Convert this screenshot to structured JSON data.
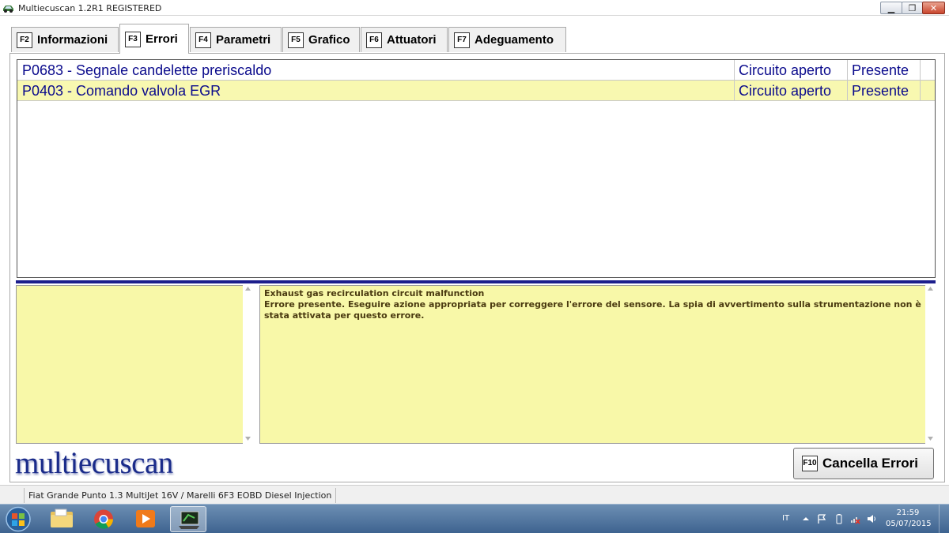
{
  "window": {
    "title": "Multiecuscan 1.2R1 REGISTERED",
    "min_glyph": "▁",
    "max_glyph": "❐",
    "close_glyph": "✕"
  },
  "tabs": [
    {
      "key": "F2",
      "label": "Informazioni"
    },
    {
      "key": "F3",
      "label": "Errori"
    },
    {
      "key": "F4",
      "label": "Parametri"
    },
    {
      "key": "F5",
      "label": "Grafico"
    },
    {
      "key": "F6",
      "label": "Attuatori"
    },
    {
      "key": "F7",
      "label": "Adeguamento"
    }
  ],
  "errors": [
    {
      "code_desc": "P0683 - Segnale candelette preriscaldo",
      "status": "Circuito aperto",
      "presence": "Presente"
    },
    {
      "code_desc": "P0403 - Comando valvola EGR",
      "status": "Circuito aperto",
      "presence": "Presente"
    }
  ],
  "description": {
    "line1": "Exhaust gas recirculation circuit malfunction",
    "line2": "Errore presente. Eseguire azione appropriata per correggere l'errore del sensore. La spia di avvertimento sulla strumentazione non è stata attivata per questo errore."
  },
  "brand": "multiecuscan",
  "clear_button": {
    "key": "F10",
    "label": "Cancella Errori"
  },
  "status_bar": {
    "vehicle": "Fiat Grande Punto 1.3 MultiJet 16V / Marelli 6F3 EOBD Diesel Injection"
  },
  "taskbar": {
    "language": "IT",
    "time": "21:59",
    "date": "05/07/2015"
  },
  "colors": {
    "selected_row": "#f8f8b0",
    "error_text": "#0a0a8c",
    "divider": "#1c1e8c",
    "desc_background": "#f8f8a8"
  }
}
